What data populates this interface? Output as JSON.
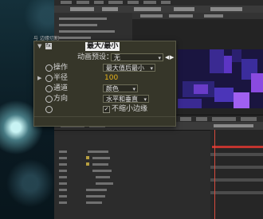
{
  "previous_effect": {
    "label": "与 边缘切割"
  },
  "effect": {
    "badge": "fx",
    "name": "最大/最小",
    "animation_presets": {
      "label": "动画预设：",
      "value": "无"
    },
    "operation": {
      "label": "操作",
      "value": "最大值后最小"
    },
    "radius": {
      "label": "半径",
      "value": "100"
    },
    "channel": {
      "label": "通道",
      "value": "颜色"
    },
    "direction": {
      "label": "方向",
      "value": "水平和垂直"
    },
    "dont_shrink_edges": {
      "label": "不缩小边缘",
      "checked": true
    }
  },
  "colors": {
    "panel_bg": "#363629",
    "value_yellow": "#e5b21a",
    "title_highlight": "#f0f0f0",
    "timeline_red": "#c2342f",
    "comp_purple": "#6a3cc8"
  },
  "icons": [
    "stopwatch-icon",
    "expand-caret-icon",
    "dropdown-arrow-icon",
    "checkbox-check-icon",
    "nav-arrow-left-icon",
    "nav-arrow-right-icon"
  ]
}
